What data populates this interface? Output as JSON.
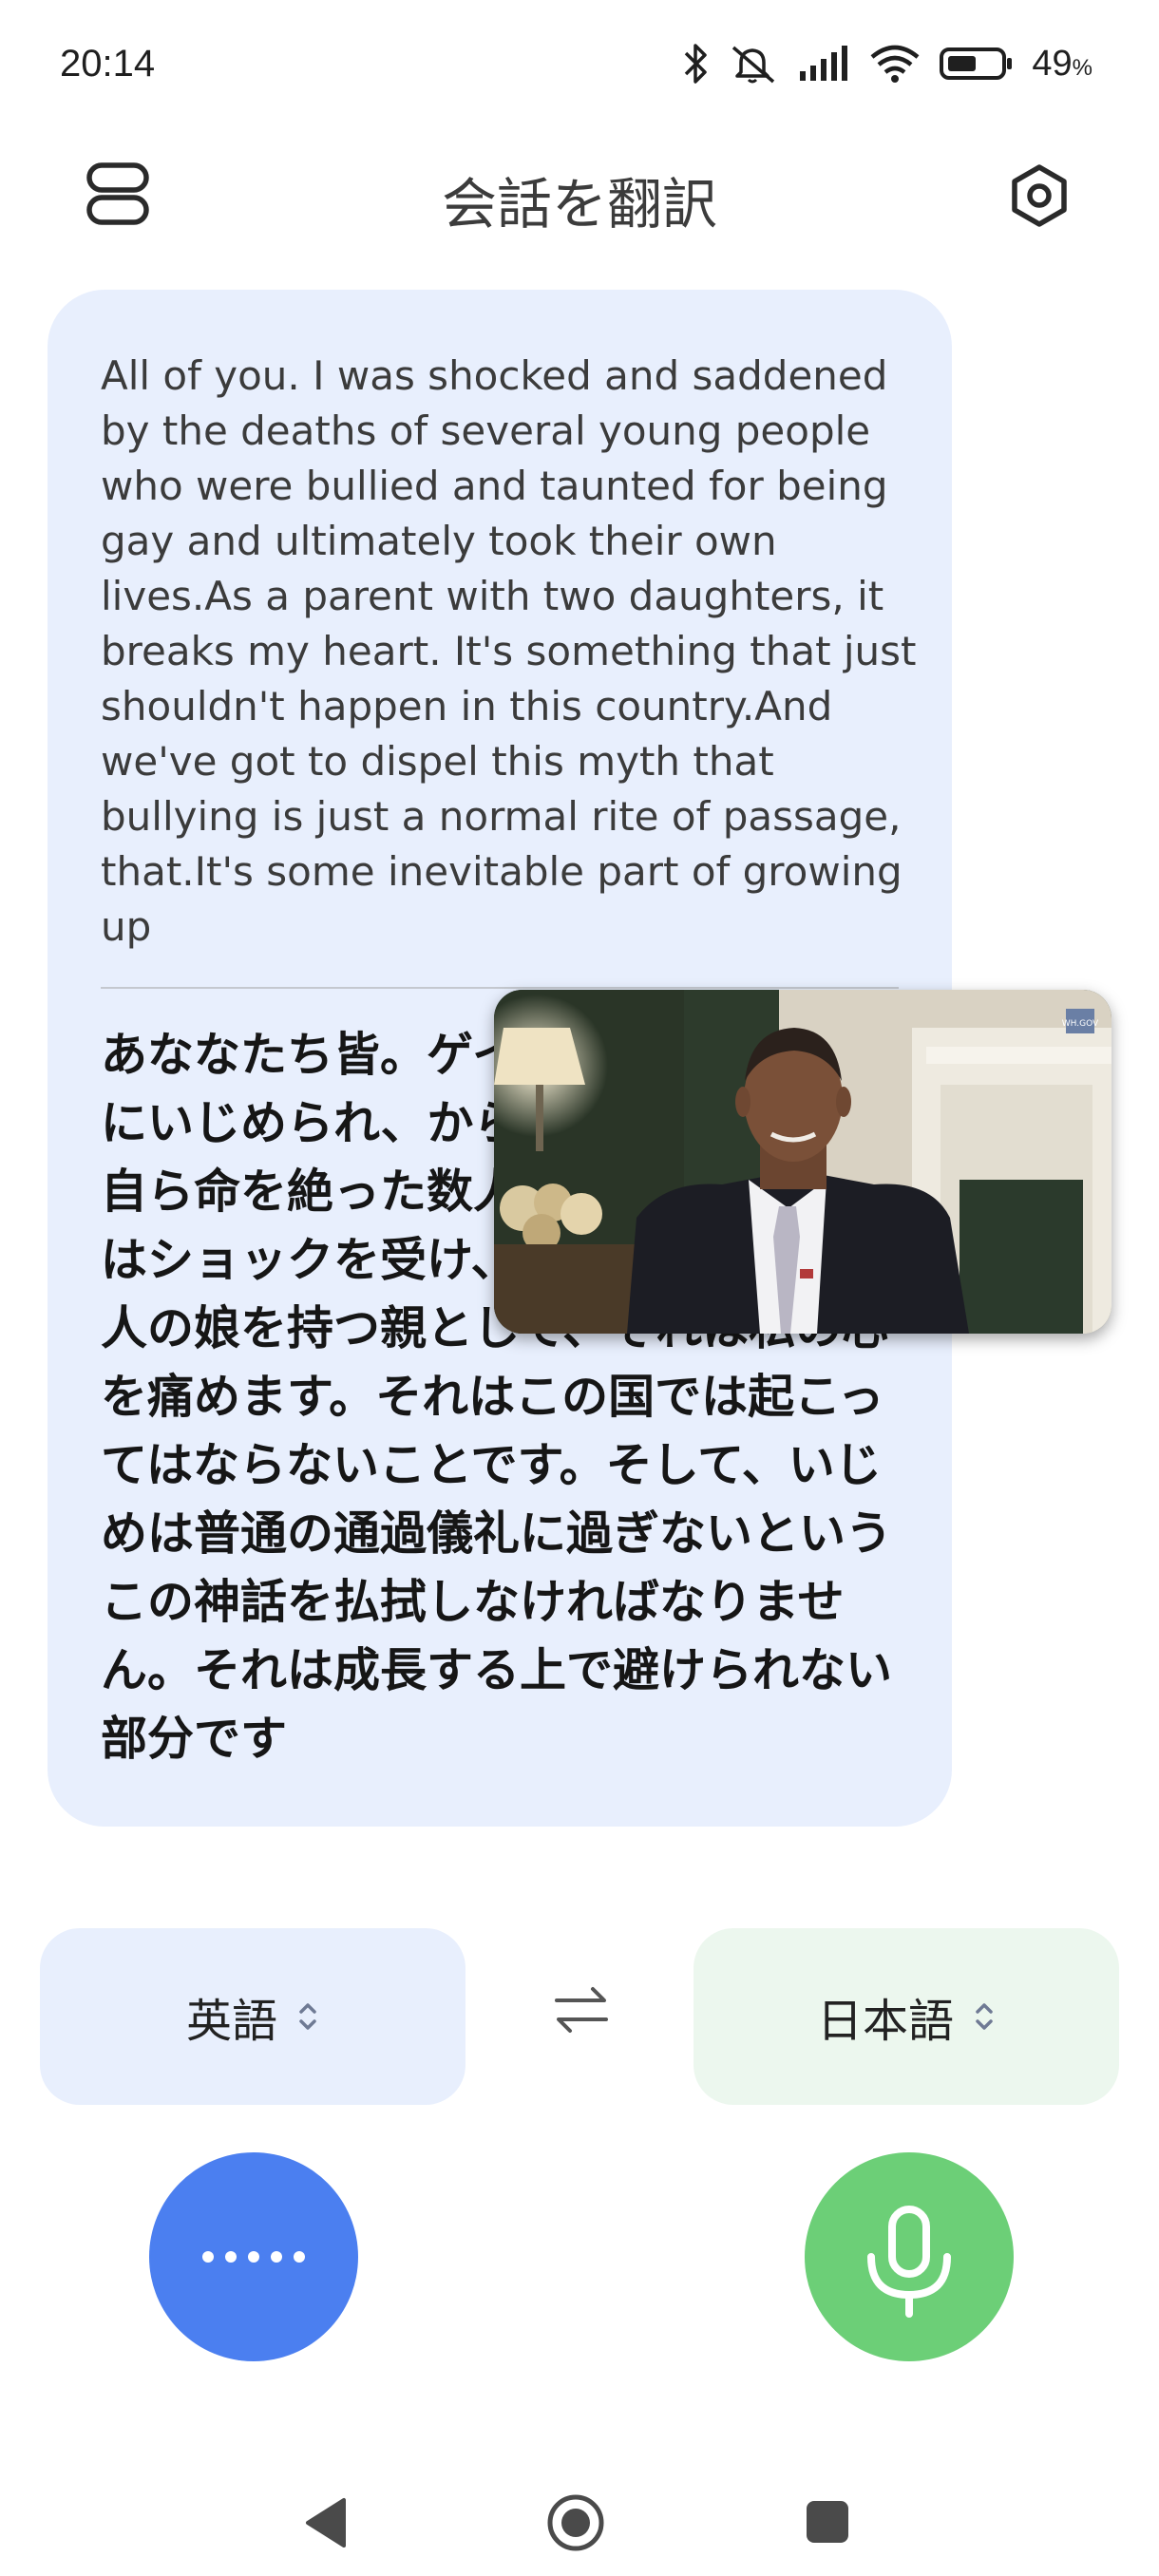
{
  "status_bar": {
    "time": "20:14",
    "battery_percent": "49",
    "battery_unit": "%",
    "icons": [
      "bluetooth-icon",
      "silent-icon",
      "signal-icon",
      "wifi-icon",
      "battery-icon"
    ]
  },
  "app_bar": {
    "title": "会話を翻訳",
    "left_icon": "conversation-layout-icon",
    "right_icon": "settings-icon"
  },
  "conversation": {
    "source_text": "All of you. I was shocked and saddened by the deaths of several young people who were bullied and taunted for being gay and ultimately took their own lives.As a parent with two daughters, it breaks my heart. It's something that just shouldn't happen in this country.And we've got to dispel this myth that bullying is just a normal rite of passage, that.It's some inevitable part of growing up",
    "translated_text": "あななたち皆。ゲイであることを理由にいじめられ、からかわれ、最終的に自ら命を絶った数人の若者の死に、私はショックを受け、悲しみました。2人の娘を持つ親として、それは私の心を痛めます。それはこの国では起こってはならないことです。そして、いじめは普通の通過儀礼に過ぎないというこの神話を払拭しなければなりません。それは成長する上で避けられない部分です"
  },
  "video_overlay": {
    "watermark": "WH.GOV"
  },
  "languages": {
    "source": "英語",
    "target": "日本語"
  },
  "colors": {
    "card_bg": "#e8effd",
    "source_lang_bg": "#e8effd",
    "target_lang_bg": "#ecf7ee",
    "left_fab": "#4b7ff0",
    "right_fab": "#6ccf77"
  }
}
